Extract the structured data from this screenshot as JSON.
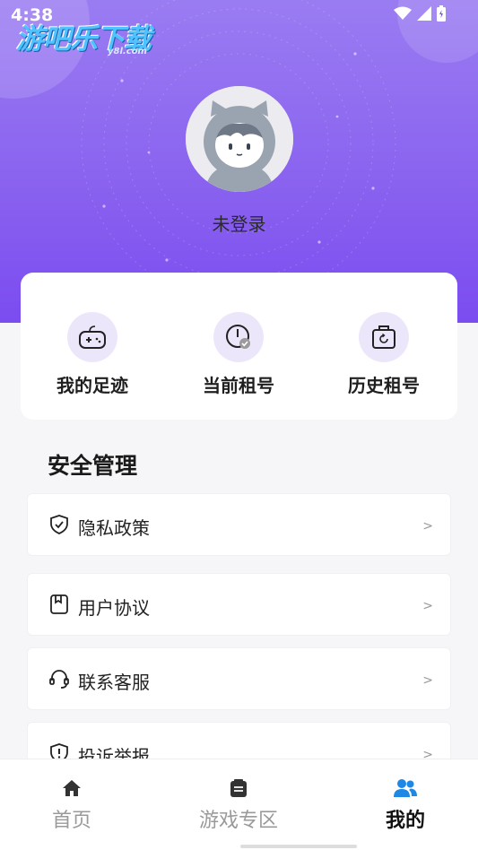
{
  "status_bar": {
    "time": "4:38"
  },
  "watermark": {
    "title": "游吧乐下载",
    "domain": "y8l.com"
  },
  "profile": {
    "login_status": "未登录"
  },
  "quick_actions": [
    {
      "label": "我的足迹",
      "icon": "gamepad-icon"
    },
    {
      "label": "当前租号",
      "icon": "clock-check-icon"
    },
    {
      "label": "历史租号",
      "icon": "bag-refresh-icon"
    }
  ],
  "security": {
    "title": "安全管理",
    "items": [
      {
        "label": "隐私政策",
        "icon": "shield-check-icon",
        "arrow": ">"
      },
      {
        "label": "用户协议",
        "icon": "bookmark-doc-icon",
        "arrow": ">"
      },
      {
        "label": "联系客服",
        "icon": "headset-icon",
        "arrow": ">"
      },
      {
        "label": "投诉举报",
        "icon": "alert-shield-icon",
        "arrow": ">"
      }
    ]
  },
  "bottom_nav": [
    {
      "label": "首页",
      "icon": "home-icon",
      "active": false
    },
    {
      "label": "游戏专区",
      "icon": "list-doc-icon",
      "active": false
    },
    {
      "label": "我的",
      "icon": "users-icon",
      "active": true
    }
  ],
  "colors": {
    "accent": "#8a63ef",
    "nav_active_icon": "#1e88e5"
  }
}
